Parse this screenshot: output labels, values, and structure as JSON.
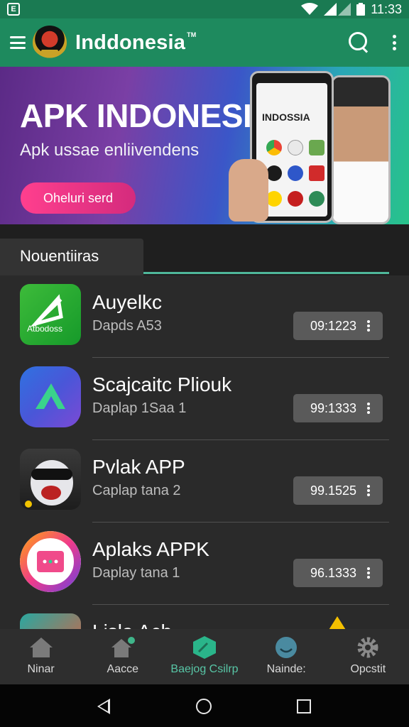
{
  "status_bar": {
    "notification_glyph": "E",
    "time": "11:33"
  },
  "app_bar": {
    "title": "Inddonesia",
    "trademark": "TM"
  },
  "banner": {
    "title": "APK INDONESIA",
    "subtitle": "Apk ussae enliivendens",
    "button_label": "Oheluri serd",
    "phone_text": "INDOSSIA"
  },
  "section": {
    "tab_label": "Nouentiiras"
  },
  "apps": [
    {
      "title": "Auyelkc",
      "subtitle": "Dapds A53",
      "action": "09:1223",
      "icon_text": "Atbodoss",
      "icon": "green-arrow-icon"
    },
    {
      "title": "Scajcaitc Pliouk",
      "subtitle": "Daplap 1Saa 1",
      "action": "99:1333",
      "icon": "blue-chevron-icon"
    },
    {
      "title": "Pvlak APP",
      "subtitle": "Caplap tana 2",
      "action": "99.1525",
      "icon": "character-icon"
    },
    {
      "title": "Aplaks APPK",
      "subtitle": "Daplay tana 1",
      "action": "96.1333",
      "icon": "chat-bubble-icon"
    },
    {
      "title": "Lisla Ach",
      "subtitle": "",
      "action": "",
      "icon": "partial-icon"
    }
  ],
  "bottom_nav": [
    {
      "label": "Ninar",
      "icon": "home-icon"
    },
    {
      "label": "Aacce",
      "icon": "home-plus-icon"
    },
    {
      "label": "Baejog Csilrp",
      "icon": "hexagon-icon",
      "active": true
    },
    {
      "label": "Nainde:",
      "icon": "face-icon"
    },
    {
      "label": "Opcstit",
      "icon": "gear-icon"
    }
  ],
  "colors": {
    "accent": "#1e8a5e",
    "active_nav": "#58c6a6",
    "button_pink": "#ff3f8e"
  }
}
